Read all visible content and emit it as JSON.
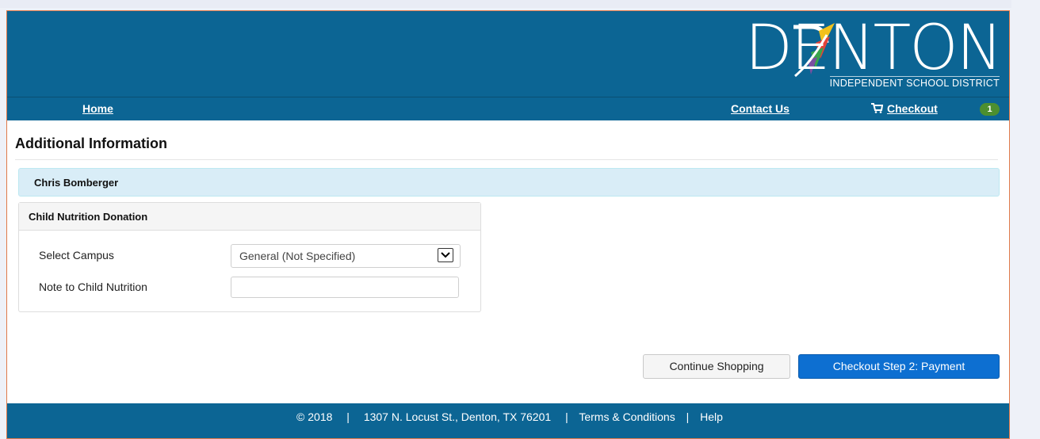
{
  "brand": {
    "logo_word": "DENTON",
    "logo_sub": "INDEPENDENT SCHOOL DISTRICT",
    "banner_color": "#0c6594"
  },
  "nav": {
    "home": "Home",
    "contact": "Contact Us",
    "checkout": "Checkout",
    "cart_count": "1",
    "cart_icon": "shopping-cart-icon"
  },
  "page": {
    "title": "Additional Information",
    "student_name": "Chris Bomberger"
  },
  "panel": {
    "title": "Child Nutrition Donation",
    "campus_label": "Select Campus",
    "campus_value": "General (Not Specified)",
    "note_label": "Note to Child Nutrition",
    "note_value": ""
  },
  "buttons": {
    "continue": "Continue Shopping",
    "checkout_step2": "Checkout Step 2: Payment",
    "primary_color": "#0d6fd1"
  },
  "footer": {
    "copyright": "© 2018",
    "address": "1307 N. Locust St., Denton, TX 76201",
    "terms": "Terms & Conditions",
    "help": "Help",
    "separator": "|"
  }
}
